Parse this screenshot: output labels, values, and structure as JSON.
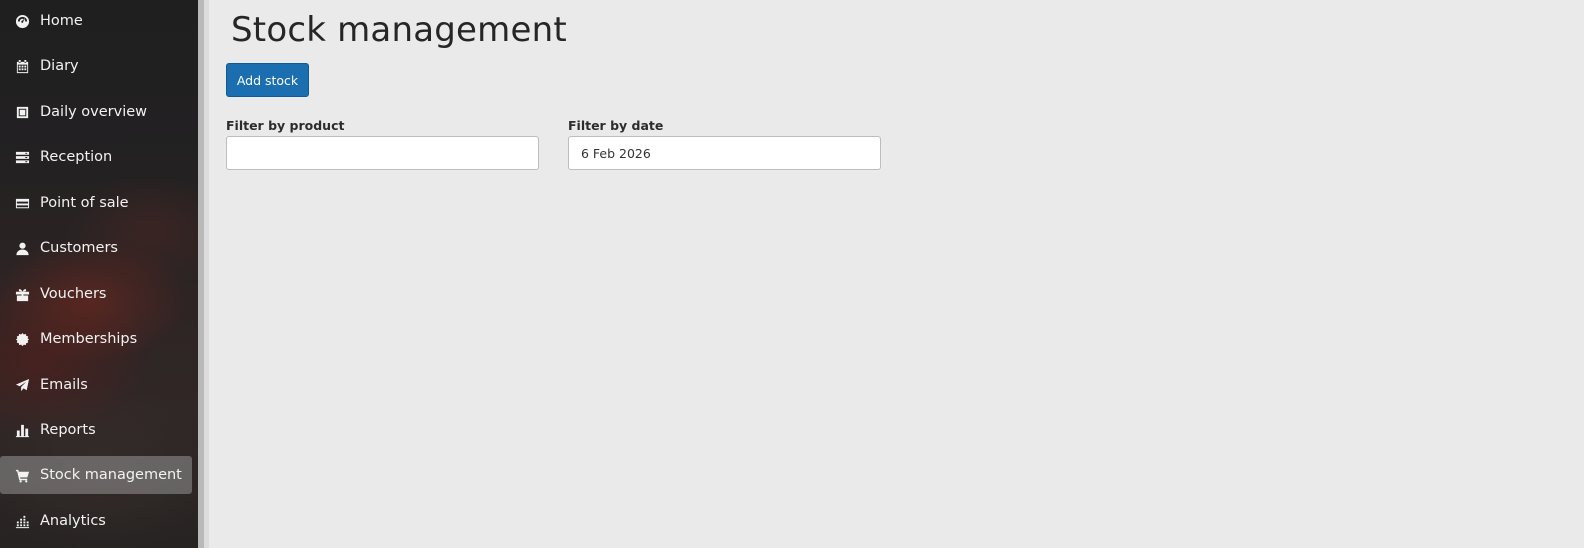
{
  "sidebar": {
    "items": [
      {
        "label": "Home",
        "icon": "dashboard-icon",
        "active": false
      },
      {
        "label": "Diary",
        "icon": "calendar-icon",
        "active": false
      },
      {
        "label": "Daily overview",
        "icon": "overview-icon",
        "active": false
      },
      {
        "label": "Reception",
        "icon": "server-icon",
        "active": false
      },
      {
        "label": "Point of sale",
        "icon": "credit-card-icon",
        "active": false
      },
      {
        "label": "Customers",
        "icon": "user-icon",
        "active": false
      },
      {
        "label": "Vouchers",
        "icon": "gift-icon",
        "active": false
      },
      {
        "label": "Memberships",
        "icon": "certificate-icon",
        "active": false
      },
      {
        "label": "Emails",
        "icon": "paper-plane-icon",
        "active": false
      },
      {
        "label": "Reports",
        "icon": "bar-chart-icon",
        "active": false
      },
      {
        "label": "Stock management",
        "icon": "cart-icon",
        "active": true
      },
      {
        "label": "Analytics",
        "icon": "analytics-icon",
        "active": false
      }
    ]
  },
  "main": {
    "title": "Stock management",
    "add_button_label": "Add stock",
    "filters": {
      "product": {
        "label": "Filter by product",
        "value": "",
        "placeholder": ""
      },
      "date": {
        "label": "Filter by date",
        "value": "6 Feb 2026"
      }
    }
  },
  "colors": {
    "primary_button": "#1b6fb0",
    "content_background": "#eaeaea",
    "sidebar_active": "#8e8e8e"
  }
}
